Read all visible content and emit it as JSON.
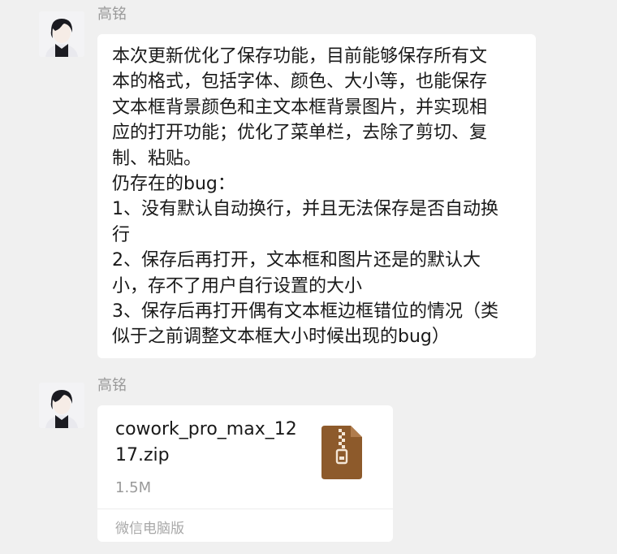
{
  "messages": [
    {
      "sender": "高铭",
      "text_lines": [
        "本次更新优化了保存功能，目前能够保存所有文",
        "本的格式，包括字体、颜色、大小等，也能保存",
        "文本框背景颜色和主文本框背景图片，并实现相",
        "应的打开功能；优化了菜单栏，去除了剪切、复",
        "制、粘贴。",
        "仍存在的bug：",
        "1、没有默认自动换行，并且无法保存是否自动换",
        "行",
        "2、保存后再打开，文本框和图片还是的默认大",
        "小，存不了用户自行设置的大小",
        "3、保存后再打开偶有文本框边框错位的情况（类",
        "似于之前调整文本框大小时候出现的bug）"
      ]
    },
    {
      "sender": "高铭",
      "file": {
        "name_lines": [
          "cowork_pro_max_12",
          "17.zip"
        ],
        "size": "1.5M",
        "icon": "zip-archive-icon",
        "source": "微信电脑版"
      }
    }
  ],
  "colors": {
    "background": "#f0f0f0",
    "bubble": "#ffffff",
    "sender": "#9a9a9a",
    "zip_icon": "#8d5a2b"
  }
}
